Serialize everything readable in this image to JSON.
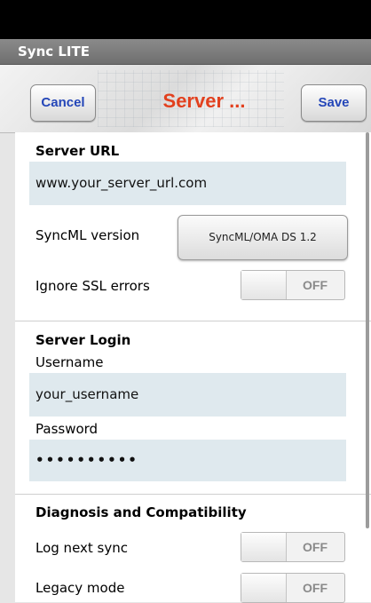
{
  "app_title": "Sync LITE",
  "toolbar": {
    "cancel_label": "Cancel",
    "title": "Server ...",
    "save_label": "Save"
  },
  "server": {
    "section_title": "Server URL",
    "url_value": "www.your_server_url.com",
    "syncml_label": "SyncML version",
    "syncml_value": "SyncML/OMA DS 1.2",
    "ssl_label": "Ignore SSL errors",
    "ssl_state": "OFF"
  },
  "login": {
    "section_title": "Server Login",
    "username_label": "Username",
    "username_value": "your_username",
    "password_label": "Password",
    "password_value": "••••••••••"
  },
  "diagnosis": {
    "section_title": "Diagnosis and Compatibility",
    "log_label": "Log next sync",
    "log_state": "OFF",
    "legacy_label": "Legacy mode",
    "legacy_state": "OFF"
  },
  "colors": {
    "accent_title": "#e2401e",
    "button_text": "#2446b8",
    "field_bg": "#dfe9ee"
  }
}
